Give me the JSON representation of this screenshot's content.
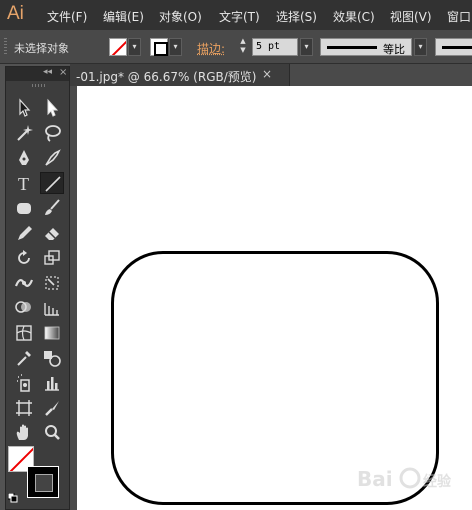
{
  "app": {
    "logo": "Ai"
  },
  "menu": {
    "items": [
      "文件(F)",
      "编辑(E)",
      "对象(O)",
      "文字(T)",
      "选择(S)",
      "效果(C)",
      "视图(V)",
      "窗口"
    ]
  },
  "control_bar": {
    "selection_status": "未选择对象",
    "stroke_label": "描边",
    "stroke_label_colon": ":",
    "stroke_weight": "5 pt",
    "profile_label": "等比"
  },
  "document": {
    "tab_title": "-01.jpg* @ 66.67% (RGB/预览)",
    "close_glyph": "×"
  },
  "toolbox": {
    "collapse_glyph": "◂◂",
    "close_glyph": "×",
    "swap_glyph": "⇆"
  },
  "colors": {
    "menubar_bg": "#323232",
    "controlbar_bg": "#494949",
    "panel_bg": "#3d3d3d",
    "stroke_label": "#e8a060",
    "canvas": "#ffffff",
    "shape_stroke": "#000000",
    "none_slash": "#e00000"
  },
  "canvas_shape": {
    "type": "rounded-rectangle",
    "fill": "none",
    "stroke": "black"
  }
}
